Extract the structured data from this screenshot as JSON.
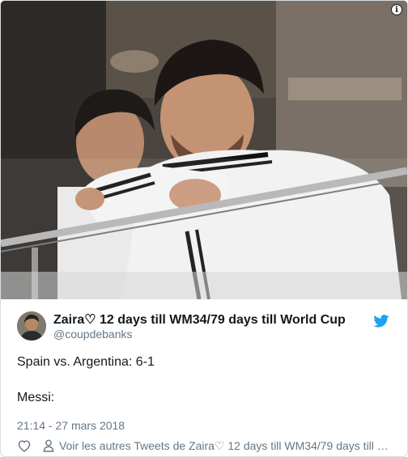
{
  "photo": {
    "alt_icon": "info-icon",
    "info_glyph": "i"
  },
  "author": {
    "display_name": "Zaira♡ 12 days till WM34/79 days till World Cup",
    "handle": "@coupdebanks",
    "avatar_icon": "avatar"
  },
  "tweet": {
    "line1": "Spain vs. Argentina: 6-1",
    "line2": "Messi:",
    "timestamp": "21:14 - 27 mars 2018"
  },
  "actions": {
    "like_icon": "heart-icon",
    "more_icon": "person-icon",
    "more_label": "Voir les autres Tweets de Zaira♡ 12 days till WM34/79 days till …"
  },
  "colors": {
    "twitter_blue": "#1da1f2",
    "secondary_text": "#657786",
    "primary_text": "#14171a"
  }
}
